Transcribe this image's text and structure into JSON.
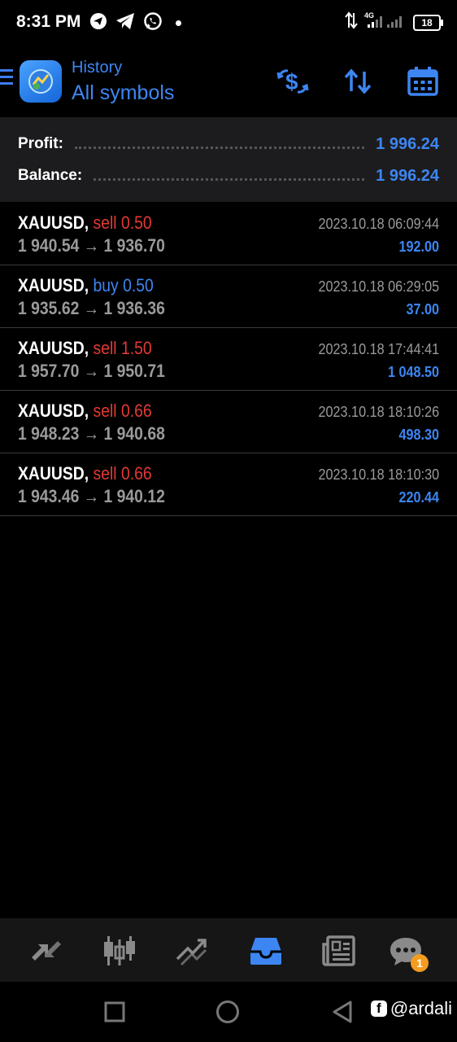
{
  "status_bar": {
    "time": "8:31 PM",
    "network": "4G",
    "battery": "18",
    "icons": [
      "telegram-outline-icon",
      "telegram-icon",
      "whatsapp-icon",
      "notification-dot-icon",
      "data-arrows-icon",
      "signal-icon",
      "battery-icon"
    ]
  },
  "header": {
    "subtitle": "History",
    "title": "All symbols",
    "actions": [
      "currency-exchange-icon",
      "sort-icon",
      "calendar-icon"
    ]
  },
  "summary": {
    "profit_label": "Profit:",
    "profit_value": "1 996.24",
    "balance_label": "Balance:",
    "balance_value": "1 996.24"
  },
  "deals": [
    {
      "symbol": "XAUUSD,",
      "side": "sell",
      "volume": "0.50",
      "open": "1 940.54",
      "arrow": "→",
      "close": "1 936.70",
      "time": "2023.10.18 06:09:44",
      "profit": "192.00"
    },
    {
      "symbol": "XAUUSD,",
      "side": "buy",
      "volume": "0.50",
      "open": "1 935.62",
      "arrow": "→",
      "close": "1 936.36",
      "time": "2023.10.18 06:29:05",
      "profit": "37.00"
    },
    {
      "symbol": "XAUUSD,",
      "side": "sell",
      "volume": "1.50",
      "open": "1 957.70",
      "arrow": "→",
      "close": "1 950.71",
      "time": "2023.10.18 17:44:41",
      "profit": "1 048.50"
    },
    {
      "symbol": "XAUUSD,",
      "side": "sell",
      "volume": "0.66",
      "open": "1 948.23",
      "arrow": "→",
      "close": "1 940.68",
      "time": "2023.10.18 18:10:26",
      "profit": "498.30"
    },
    {
      "symbol": "XAUUSD,",
      "side": "sell",
      "volume": "0.66",
      "open": "1 943.46",
      "arrow": "→",
      "close": "1 940.12",
      "time": "2023.10.18 18:10:30",
      "profit": "220.44"
    }
  ],
  "bottom_nav": {
    "items": [
      "quotes-icon",
      "chart-icon",
      "trade-icon",
      "history-icon",
      "news-icon",
      "messages-icon"
    ],
    "active": "history-icon",
    "messages_badge": "1"
  },
  "system_nav": {
    "buttons": [
      "recents-icon",
      "home-icon",
      "back-icon"
    ],
    "watermark": "@ardali"
  },
  "colors": {
    "accent": "#3d86f2",
    "sell": "#e53935",
    "muted": "#9a9a9a",
    "panel": "#1c1c1e",
    "badge": "#f39c1f"
  }
}
